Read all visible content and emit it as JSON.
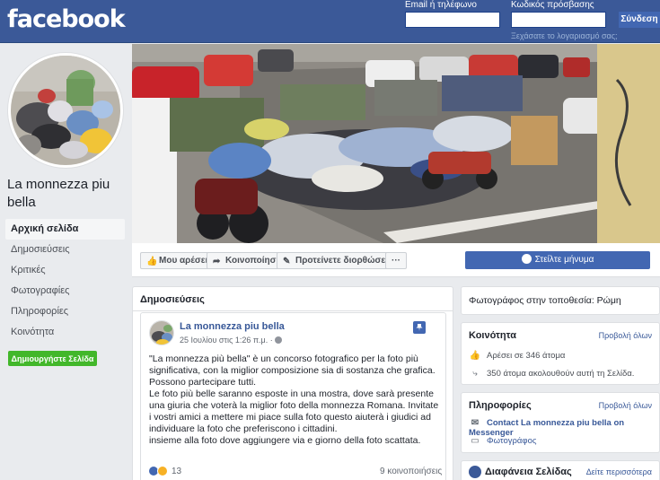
{
  "header": {
    "logo": "facebook",
    "email_label": "Email ή τηλέφωνο",
    "password_label": "Κωδικός πρόσβασης",
    "email_value": "",
    "password_value": "",
    "login_button": "Σύνδεση",
    "forgot_link": "Ξεχάσατε το λογαριασμό σας;"
  },
  "page": {
    "name": "La monnezza piu bella"
  },
  "nav": {
    "items": [
      {
        "label": "Αρχική σελίδα",
        "active": true
      },
      {
        "label": "Δημοσιεύσεις"
      },
      {
        "label": "Κριτικές"
      },
      {
        "label": "Φωτογραφίες"
      },
      {
        "label": "Πληροφορίες"
      },
      {
        "label": "Κοινότητα"
      }
    ],
    "create_page": "Δημιουργήστε Σελίδα"
  },
  "actions": {
    "like": "Μου αρέσει!",
    "share": "Κοινοποίηση",
    "suggest": "Προτείνετε διορθώσεις",
    "more": "···",
    "send_message": "Στείλτε μήνυμα"
  },
  "posts": {
    "title": "Δημοσιεύσεις",
    "post": {
      "author": "La monnezza piu bella",
      "date": "25 Ιουλίου στις 1:26 π.μ. · ",
      "paragraphs": [
        "\"La monnezza più bella\" è un concorso fotografico per la foto più significativa, con la miglior composizione sia di sostanza che grafica.",
        "Possono partecipare tutti.",
        "Le foto più belle saranno esposte in una mostra, dove sarà presente una giuria che voterà la miglior foto della monnezza Romana. Invitate i vostri amici a mettere mi piace sulla foto questo aiuterà i giudici ad individuare la foto che preferiscono i cittadini.",
        "insieme alla foto dove aggiungere via e giorno della foto scattata."
      ],
      "reaction_count": "13",
      "shares": "9 κοινοποιήσεις"
    }
  },
  "sidebar": {
    "location": "Φωτογράφος στην τοποθεσία: Ρώμη",
    "community": {
      "title": "Κοινότητα",
      "link": "Προβολή όλων",
      "likes": "Αρέσει σε 346 άτομα",
      "follows": "350 άτομα ακολουθούν αυτή τη Σελίδα."
    },
    "info": {
      "title": "Πληροφορίες",
      "link": "Προβολή όλων",
      "messenger": "Contact La monnezza piu bella on Messenger",
      "photos": "Φωτογράφος"
    },
    "transparency": {
      "title": "Διαφάνεια Σελίδας",
      "link": "Δείτε περισσότερα"
    }
  },
  "colors": {
    "brand": "#3b5998",
    "button": "#4267b2",
    "link": "#385898",
    "green": "#42b72a"
  }
}
